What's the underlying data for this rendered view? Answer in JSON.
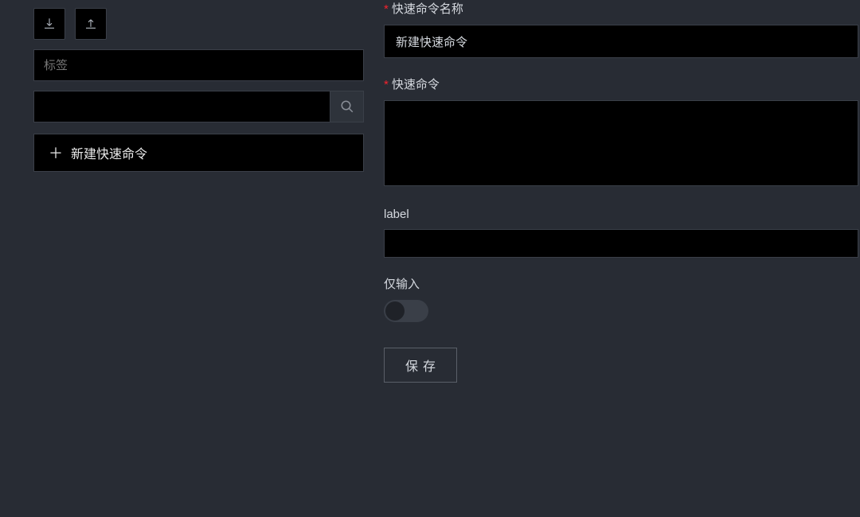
{
  "sidebar": {
    "tag_placeholder": "标签",
    "search_value": "",
    "new_cmd_label": "新建快速命令"
  },
  "form": {
    "name_label": "快速命令名称",
    "name_value": "新建快速命令",
    "command_label": "快速命令",
    "command_value": "",
    "label_label": "label",
    "label_value": "",
    "only_input_label": "仅输入",
    "only_input_value": false,
    "save_label": "保存"
  },
  "icons": {
    "download": "download-icon",
    "upload": "upload-icon",
    "search": "search-icon",
    "plus": "plus-icon"
  }
}
